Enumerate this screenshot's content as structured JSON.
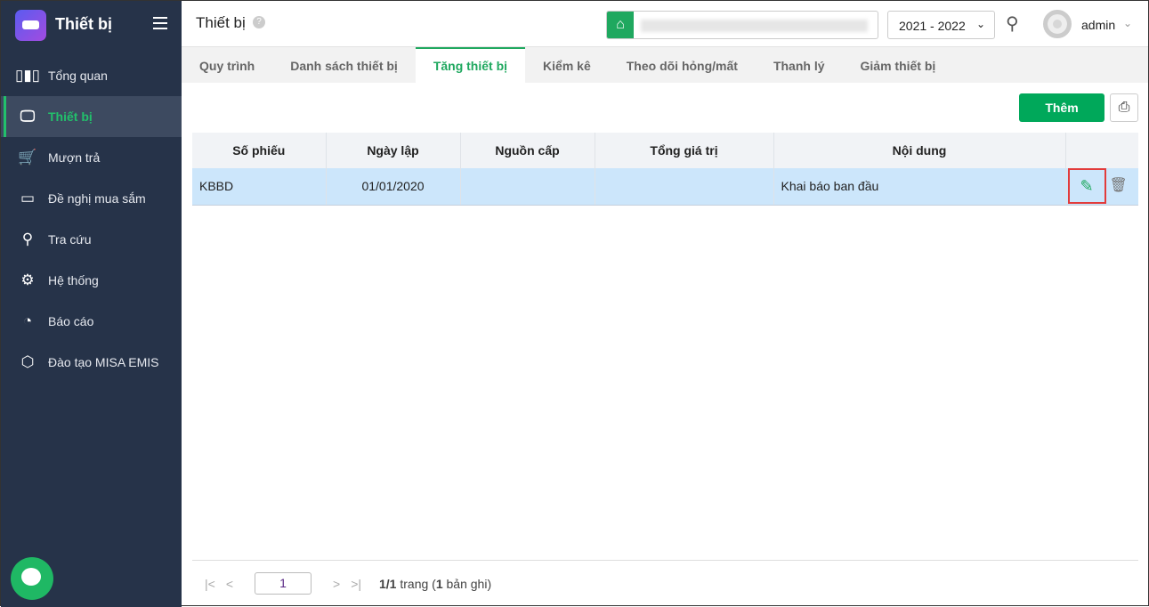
{
  "app": {
    "title": "Thiết bị"
  },
  "sidebar": {
    "items": [
      {
        "label": "Tổng quan",
        "icon": "chart-bars-icon"
      },
      {
        "label": "Thiết bị",
        "icon": "monitor-icon",
        "active": true
      },
      {
        "label": "Mượn trả",
        "icon": "cart-icon"
      },
      {
        "label": "Đề nghị mua sắm",
        "icon": "projector-icon"
      },
      {
        "label": "Tra cứu",
        "icon": "search-icon"
      },
      {
        "label": "Hệ thống",
        "icon": "gear-icon"
      },
      {
        "label": "Báo cáo",
        "icon": "pie-chart-icon"
      },
      {
        "label": "Đào tạo MISA EMIS",
        "icon": "box-icon"
      }
    ]
  },
  "header": {
    "title": "Thiết bị",
    "help": "?",
    "year": "2021 - 2022",
    "user": "admin"
  },
  "tabs": [
    "Quy trình",
    "Danh sách thiết bị",
    "Tăng thiết bị",
    "Kiểm kê",
    "Theo dõi hỏng/mất",
    "Thanh lý",
    "Giảm thiết bị"
  ],
  "toolbar": {
    "add_label": "Thêm"
  },
  "table": {
    "headers": [
      "Số phiếu",
      "Ngày lập",
      "Nguồn cấp",
      "Tổng giá trị",
      "Nội dung",
      ""
    ],
    "rows": [
      [
        "KBBD",
        "01/01/2020",
        "",
        "",
        "Khai báo ban đầu"
      ]
    ]
  },
  "pager": {
    "page": "1",
    "current": "1/1",
    "trang": " trang (",
    "count": "1",
    "tail": " bản ghi)"
  }
}
